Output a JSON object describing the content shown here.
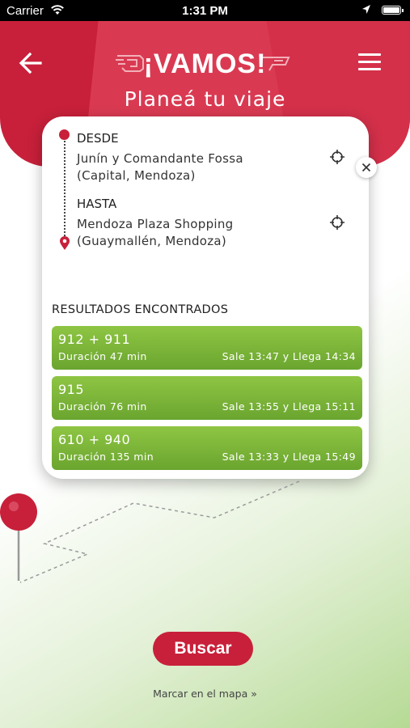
{
  "status_bar": {
    "carrier": "Carrier",
    "time": "1:31 PM"
  },
  "header": {
    "app_title": "¡VAMOS!",
    "page_title": "Planeá tu viaje"
  },
  "trip": {
    "origin_label": "DESDE",
    "origin_line1": "Junín y Comandante Fossa",
    "origin_line2": "(Capital, Mendoza)",
    "destination_label": "HASTA",
    "destination_line1": "Mendoza Plaza Shopping",
    "destination_line2": "(Guaymallén, Mendoza)"
  },
  "results": {
    "title": "RESULTADOS ENCONTRADOS",
    "items": [
      {
        "lines": "912 + 911",
        "duration": "Duración 47 min",
        "schedule": "Sale 13:47 y Llega 14:34"
      },
      {
        "lines": "915",
        "duration": "Duración 76 min",
        "schedule": "Sale 13:55 y Llega 15:11"
      },
      {
        "lines": "610 + 940",
        "duration": "Duración 135 min",
        "schedule": "Sale 13:33 y Llega 15:49"
      }
    ]
  },
  "actions": {
    "search_label": "Buscar",
    "map_link": "Marcar en el mapa »"
  },
  "colors": {
    "brand_red": "#c8203a",
    "result_green": "#7cb53a"
  },
  "icons": {
    "back": "arrow-left-icon",
    "menu": "hamburger-menu-icon",
    "locate": "crosshair-icon",
    "close": "close-icon",
    "destination": "map-pin-icon"
  }
}
